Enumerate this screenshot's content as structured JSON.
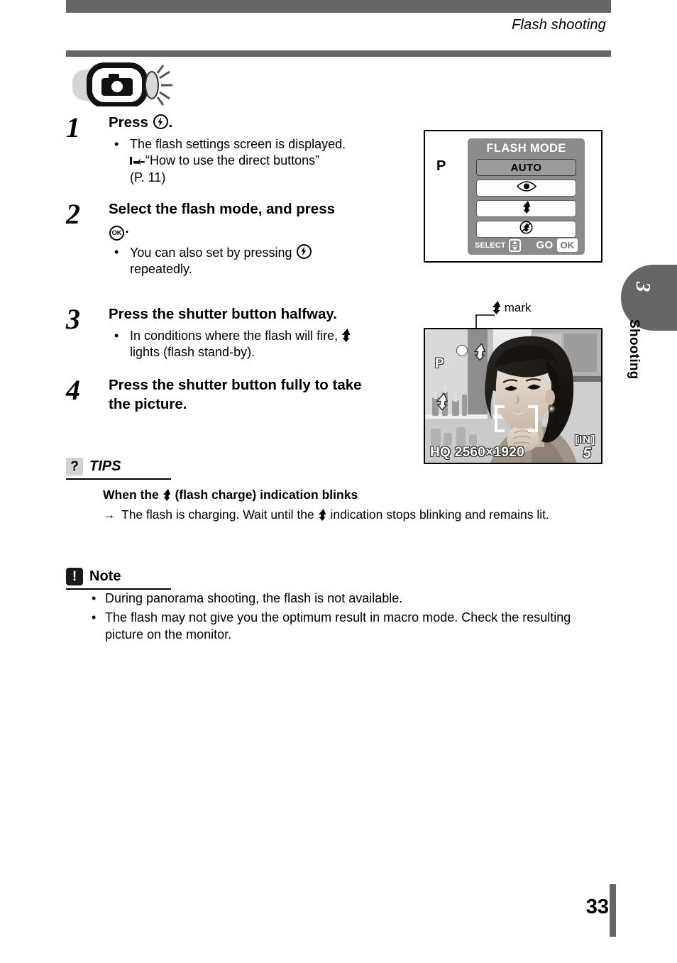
{
  "header": {
    "title": "Flash shooting",
    "mode_icon": "camera-flash-mode-icon"
  },
  "steps": [
    {
      "number": "1",
      "title_before": "Press",
      "title_icon": "flash-button-icon",
      "title_after": ".",
      "bullets": [
        {
          "bullet": "•",
          "text_1": "The flash settings screen is displayed.",
          "pointer_icon": "pointing-hand-icon",
          "text_2": "“How to use the direct buttons”",
          "text_3": "(P. 11)"
        }
      ]
    },
    {
      "number": "2",
      "title_before": "Select the flash mode, and press",
      "title_icon": "ok-button-icon",
      "title_icon_label": "OK",
      "title_after": ".",
      "bullets": [
        {
          "bullet": "•",
          "text_1": "You can also set by pressing",
          "icon": "flash-button-icon",
          "text_2": "repeatedly."
        }
      ]
    },
    {
      "number": "3",
      "title": "Press the shutter button halfway.",
      "bullets": [
        {
          "bullet": "•",
          "text_1": "In conditions where the flash will fire,",
          "icon": "flash-bolt-icon",
          "text_2": "lights (flash stand-by)."
        }
      ]
    },
    {
      "number": "4",
      "title": "Press the shutter button fully to take the picture."
    }
  ],
  "flash_mode_screen": {
    "mode_indicator": "P",
    "header": "FLASH MODE",
    "options": [
      {
        "label": "AUTO",
        "icon": "",
        "selected": true
      },
      {
        "label": "",
        "icon": "red-eye-icon",
        "selected": false
      },
      {
        "label": "",
        "icon": "fill-in-flash-icon",
        "selected": false
      },
      {
        "label": "",
        "icon": "flash-off-icon",
        "selected": false
      }
    ],
    "footer": {
      "select_label": "SELECT",
      "select_key_icon": "up-down-arrow-key-icon",
      "go_label": "GO",
      "ok_key_label": "OK"
    }
  },
  "mark_callout": {
    "icon": "flash-bolt-icon",
    "label": "mark"
  },
  "preview_screen": {
    "mode_indicator": "P",
    "flash_mark_icon": "flash-stand-by-icon",
    "self_timer_dot_icon": "white-dot-icon",
    "af_bracket_icon": "af-target-bracket-icon",
    "quality": "HQ",
    "resolution": "2560×1920",
    "memory": "[IN]",
    "shots_remaining": "5"
  },
  "tips": {
    "badge": "?",
    "title": "TIPS",
    "subtitle_before": "When the",
    "subtitle_icon": "flash-bolt-icon",
    "subtitle_after": "(flash charge) indication blinks",
    "arrow": "→",
    "body_1": "The flash is charging. Wait until the",
    "body_icon": "flash-bolt-icon",
    "body_2": "indication stops blinking and remains lit."
  },
  "note": {
    "badge": "!",
    "title": "Note",
    "items": [
      {
        "bullet": "•",
        "text": "During panorama shooting, the flash is not available."
      },
      {
        "bullet": "•",
        "text": "The flash may not give you the optimum result in macro mode. Check the resulting picture on the monitor."
      }
    ]
  },
  "side_tab": {
    "number": "3",
    "label": "Shooting"
  },
  "footer": {
    "page_number": "33"
  },
  "colors": {
    "header_bar": "#666666",
    "panel_gray": "#8b8b8b",
    "tips_badge": "#d2d2d2",
    "note_badge": "#1a1a1a"
  }
}
